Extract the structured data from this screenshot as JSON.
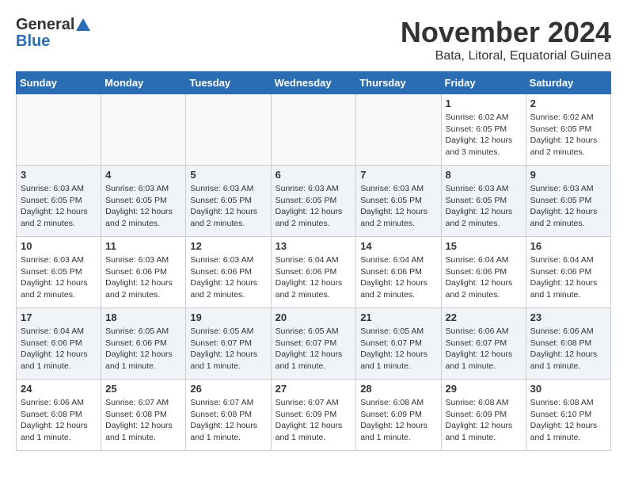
{
  "logo": {
    "general": "General",
    "blue": "Blue"
  },
  "title": "November 2024",
  "subtitle": "Bata, Litoral, Equatorial Guinea",
  "days_of_week": [
    "Sunday",
    "Monday",
    "Tuesday",
    "Wednesday",
    "Thursday",
    "Friday",
    "Saturday"
  ],
  "weeks": [
    [
      {
        "day": "",
        "info": ""
      },
      {
        "day": "",
        "info": ""
      },
      {
        "day": "",
        "info": ""
      },
      {
        "day": "",
        "info": ""
      },
      {
        "day": "",
        "info": ""
      },
      {
        "day": "1",
        "info": "Sunrise: 6:02 AM\nSunset: 6:05 PM\nDaylight: 12 hours and 3 minutes."
      },
      {
        "day": "2",
        "info": "Sunrise: 6:02 AM\nSunset: 6:05 PM\nDaylight: 12 hours and 2 minutes."
      }
    ],
    [
      {
        "day": "3",
        "info": "Sunrise: 6:03 AM\nSunset: 6:05 PM\nDaylight: 12 hours and 2 minutes."
      },
      {
        "day": "4",
        "info": "Sunrise: 6:03 AM\nSunset: 6:05 PM\nDaylight: 12 hours and 2 minutes."
      },
      {
        "day": "5",
        "info": "Sunrise: 6:03 AM\nSunset: 6:05 PM\nDaylight: 12 hours and 2 minutes."
      },
      {
        "day": "6",
        "info": "Sunrise: 6:03 AM\nSunset: 6:05 PM\nDaylight: 12 hours and 2 minutes."
      },
      {
        "day": "7",
        "info": "Sunrise: 6:03 AM\nSunset: 6:05 PM\nDaylight: 12 hours and 2 minutes."
      },
      {
        "day": "8",
        "info": "Sunrise: 6:03 AM\nSunset: 6:05 PM\nDaylight: 12 hours and 2 minutes."
      },
      {
        "day": "9",
        "info": "Sunrise: 6:03 AM\nSunset: 6:05 PM\nDaylight: 12 hours and 2 minutes."
      }
    ],
    [
      {
        "day": "10",
        "info": "Sunrise: 6:03 AM\nSunset: 6:05 PM\nDaylight: 12 hours and 2 minutes."
      },
      {
        "day": "11",
        "info": "Sunrise: 6:03 AM\nSunset: 6:06 PM\nDaylight: 12 hours and 2 minutes."
      },
      {
        "day": "12",
        "info": "Sunrise: 6:03 AM\nSunset: 6:06 PM\nDaylight: 12 hours and 2 minutes."
      },
      {
        "day": "13",
        "info": "Sunrise: 6:04 AM\nSunset: 6:06 PM\nDaylight: 12 hours and 2 minutes."
      },
      {
        "day": "14",
        "info": "Sunrise: 6:04 AM\nSunset: 6:06 PM\nDaylight: 12 hours and 2 minutes."
      },
      {
        "day": "15",
        "info": "Sunrise: 6:04 AM\nSunset: 6:06 PM\nDaylight: 12 hours and 2 minutes."
      },
      {
        "day": "16",
        "info": "Sunrise: 6:04 AM\nSunset: 6:06 PM\nDaylight: 12 hours and 1 minute."
      }
    ],
    [
      {
        "day": "17",
        "info": "Sunrise: 6:04 AM\nSunset: 6:06 PM\nDaylight: 12 hours and 1 minute."
      },
      {
        "day": "18",
        "info": "Sunrise: 6:05 AM\nSunset: 6:06 PM\nDaylight: 12 hours and 1 minute."
      },
      {
        "day": "19",
        "info": "Sunrise: 6:05 AM\nSunset: 6:07 PM\nDaylight: 12 hours and 1 minute."
      },
      {
        "day": "20",
        "info": "Sunrise: 6:05 AM\nSunset: 6:07 PM\nDaylight: 12 hours and 1 minute."
      },
      {
        "day": "21",
        "info": "Sunrise: 6:05 AM\nSunset: 6:07 PM\nDaylight: 12 hours and 1 minute."
      },
      {
        "day": "22",
        "info": "Sunrise: 6:06 AM\nSunset: 6:07 PM\nDaylight: 12 hours and 1 minute."
      },
      {
        "day": "23",
        "info": "Sunrise: 6:06 AM\nSunset: 6:08 PM\nDaylight: 12 hours and 1 minute."
      }
    ],
    [
      {
        "day": "24",
        "info": "Sunrise: 6:06 AM\nSunset: 6:08 PM\nDaylight: 12 hours and 1 minute."
      },
      {
        "day": "25",
        "info": "Sunrise: 6:07 AM\nSunset: 6:08 PM\nDaylight: 12 hours and 1 minute."
      },
      {
        "day": "26",
        "info": "Sunrise: 6:07 AM\nSunset: 6:08 PM\nDaylight: 12 hours and 1 minute."
      },
      {
        "day": "27",
        "info": "Sunrise: 6:07 AM\nSunset: 6:09 PM\nDaylight: 12 hours and 1 minute."
      },
      {
        "day": "28",
        "info": "Sunrise: 6:08 AM\nSunset: 6:09 PM\nDaylight: 12 hours and 1 minute."
      },
      {
        "day": "29",
        "info": "Sunrise: 6:08 AM\nSunset: 6:09 PM\nDaylight: 12 hours and 1 minute."
      },
      {
        "day": "30",
        "info": "Sunrise: 6:08 AM\nSunset: 6:10 PM\nDaylight: 12 hours and 1 minute."
      }
    ]
  ]
}
